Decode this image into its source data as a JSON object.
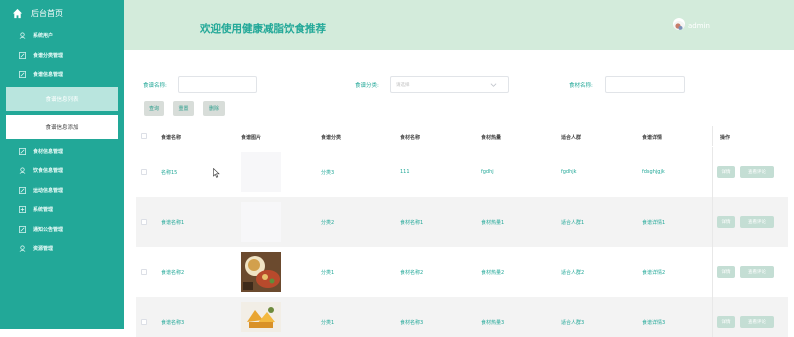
{
  "sidebar": {
    "home_label": "后台首页",
    "items_top": [
      {
        "label": "系统用户",
        "icon": "user-icon"
      },
      {
        "label": "食谱分类管理",
        "icon": "edit-icon"
      },
      {
        "label": "食谱信息管理",
        "icon": "edit-icon"
      }
    ],
    "sub_active": "食谱信息列表",
    "sub_plain": "食谱信息添加",
    "items_bottom": [
      {
        "label": "食材信息管理",
        "icon": "edit-icon"
      },
      {
        "label": "饮食信息管理",
        "icon": "user-icon"
      },
      {
        "label": "运动信息管理",
        "icon": "edit-icon"
      },
      {
        "label": "系统管理",
        "icon": "plus-square-icon"
      },
      {
        "label": "通知公告管理",
        "icon": "edit-icon"
      },
      {
        "label": "资源管理",
        "icon": "user-icon"
      }
    ]
  },
  "header": {
    "title": "欢迎使用健康减脂饮食推荐",
    "user": "admin"
  },
  "search": {
    "name_label": "食谱名称:",
    "category_label": "食谱分类:",
    "category_placeholder": "请选择",
    "ingredient_label": "食材名称:"
  },
  "toolbar": {
    "query": "查询",
    "add": "重置",
    "delete": "删除"
  },
  "table": {
    "headers": [
      "食谱名称",
      "食谱图片",
      "食谱分类",
      "食材名称",
      "食材热量",
      "适合人群",
      "食谱详情",
      "操作"
    ],
    "rows": [
      {
        "name": "名称15",
        "category": "分类3",
        "ingredient": "111",
        "calories": "fgdhj",
        "crowd": "fgdhjk",
        "detail": "fdsghjgjk"
      },
      {
        "name": "食谱名称1",
        "category": "分类2",
        "ingredient": "食材名称1",
        "calories": "食材热量1",
        "crowd": "适合人群1",
        "detail": "食谱详情1"
      },
      {
        "name": "食谱名称2",
        "category": "分类1",
        "ingredient": "食材名称2",
        "calories": "食材热量2",
        "crowd": "适合人群2",
        "detail": "食谱详情2"
      },
      {
        "name": "食谱名称3",
        "category": "分类1",
        "ingredient": "食材名称3",
        "calories": "食材热量3",
        "crowd": "适合人群3",
        "detail": "食谱详情3"
      }
    ],
    "op_detail": "详情",
    "op_review": "查看评论"
  },
  "colors": {
    "accent": "#22a898",
    "header_bg": "#d3ebdb",
    "row_alt": "#f3f3f3"
  }
}
